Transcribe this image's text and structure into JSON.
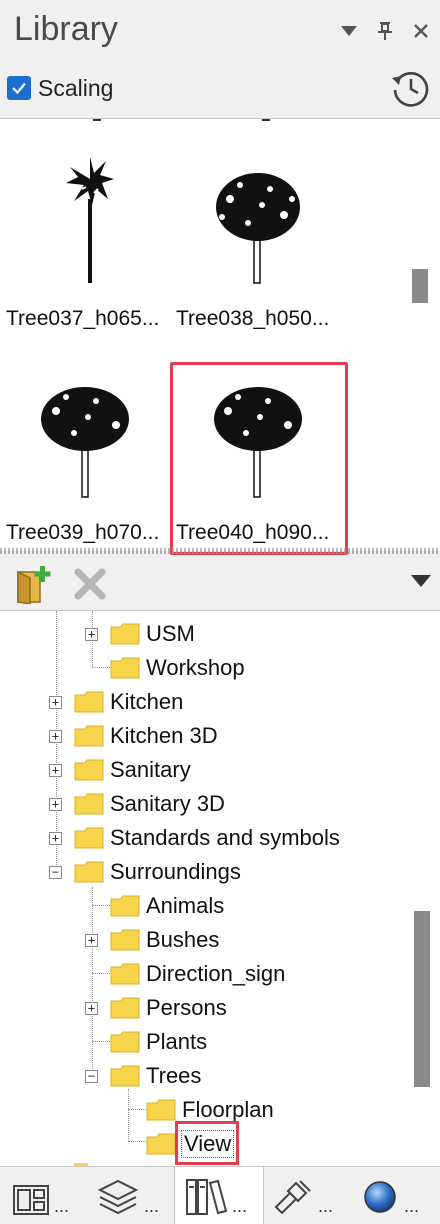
{
  "panel": {
    "title": "Library"
  },
  "toolbar": {
    "scaling_label": "Scaling",
    "scaling_checked": true
  },
  "preview": {
    "tiles": [
      {
        "label": "Tree037_h065..."
      },
      {
        "label": "Tree038_h050..."
      },
      {
        "label": "Tree039_h070..."
      },
      {
        "label": "Tree040_h090..."
      }
    ],
    "selected_tile": "Tree040_h090..."
  },
  "tree": {
    "items": [
      {
        "label": "USM"
      },
      {
        "label": "Workshop"
      },
      {
        "label": "Kitchen"
      },
      {
        "label": "Kitchen 3D"
      },
      {
        "label": "Sanitary"
      },
      {
        "label": "Sanitary 3D"
      },
      {
        "label": "Standards and symbols"
      },
      {
        "label": "Surroundings"
      },
      {
        "label": "Animals"
      },
      {
        "label": "Bushes"
      },
      {
        "label": "Direction_sign"
      },
      {
        "label": "Persons"
      },
      {
        "label": "Plants"
      },
      {
        "label": "Trees"
      },
      {
        "label": "Floorplan"
      },
      {
        "label": "View"
      }
    ],
    "selected_item": "View"
  },
  "bottom_tabs": {
    "more_label": "..."
  },
  "colors": {
    "accent": "#1c6fd1",
    "highlight": "#e0404b",
    "folder": "#f7d54a"
  }
}
